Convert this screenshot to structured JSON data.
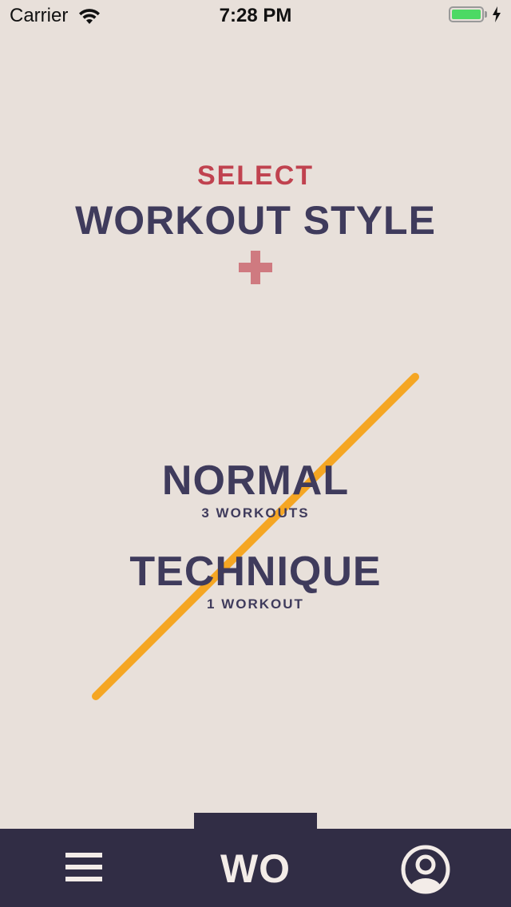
{
  "status_bar": {
    "carrier": "Carrier",
    "time": "7:28 PM",
    "battery_percent": 100
  },
  "header": {
    "select_label": "SELECT",
    "title": "WORKOUT STYLE"
  },
  "styles": [
    {
      "name": "NORMAL",
      "count": "3 WORKOUTS"
    },
    {
      "name": "TECHNIQUE",
      "count": "1 WORKOUT"
    }
  ],
  "tab_bar": {
    "logo": "WO"
  },
  "colors": {
    "background": "#e8e0da",
    "accent_red": "#c0424f",
    "plus_pink": "#cf7a80",
    "title_navy": "#3f3b5c",
    "stripe_orange": "#f5a623",
    "tab_bar": "#312d45",
    "tab_icons": "#f3ece8"
  },
  "icons": {
    "wifi": "wifi-icon",
    "battery": "battery-icon",
    "charging": "bolt-icon",
    "plus": "plus-icon",
    "menu": "hamburger-menu-icon",
    "profile": "user-profile-icon"
  }
}
